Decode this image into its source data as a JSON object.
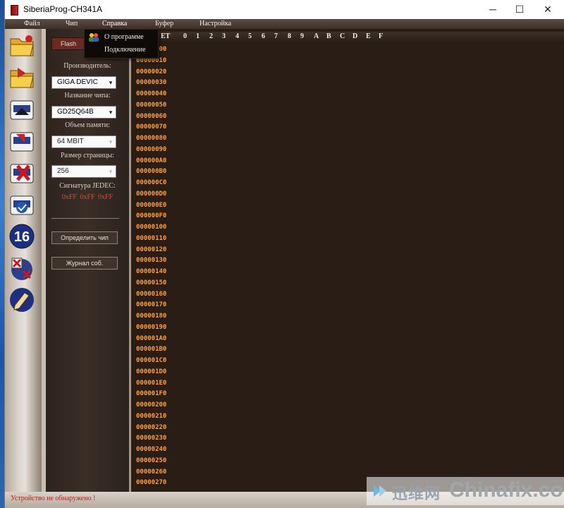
{
  "window": {
    "title": "SiberiaProg-CH341A",
    "controls": {
      "minimize": "─",
      "maximize": "☐",
      "close": "✕"
    }
  },
  "menu": {
    "items": [
      "Файл",
      "Чип",
      "Справка",
      "Буфер",
      "Настройка"
    ],
    "active": "Справка",
    "dropdown": [
      "О программе",
      "Подключение"
    ]
  },
  "toolbar": {
    "icons": [
      "open-folder-icon",
      "save-folder-icon",
      "read-chip-icon",
      "write-chip-icon",
      "erase-chip-icon",
      "verify-chip-icon",
      "bit16-icon",
      "blank-check-icon",
      "edit-icon"
    ],
    "bit_label": "16"
  },
  "panel": {
    "tab": "Flash",
    "manufacturer_label": "Производитель:",
    "manufacturer_value": "GIGA DEVIC",
    "chip_label": "Название чипа:",
    "chip_value": "GD25Q64B",
    "memory_label": "Объем памяти:",
    "memory_value": "64 MBIT",
    "page_label": "Размер страницы:",
    "page_value": "256",
    "jedec_label": "Сигнатура JEDEC:",
    "jedec_value": "0xFF  0xFF  0xFF",
    "detect_button": "Определить чип",
    "log_button": "Журнал соб."
  },
  "hex": {
    "header_label": "ET",
    "columns": [
      "0",
      "1",
      "2",
      "3",
      "4",
      "5",
      "6",
      "7",
      "8",
      "9",
      "A",
      "B",
      "C",
      "D",
      "E",
      "F"
    ],
    "offsets": [
      "00000000",
      "00000010",
      "00000020",
      "00000030",
      "00000040",
      "00000050",
      "00000060",
      "00000070",
      "00000080",
      "00000090",
      "000000A0",
      "000000B0",
      "000000C0",
      "000000D0",
      "000000E0",
      "000000F0",
      "00000100",
      "00000110",
      "00000120",
      "00000130",
      "00000140",
      "00000150",
      "00000160",
      "00000170",
      "00000180",
      "00000190",
      "000001A0",
      "000001B0",
      "000001C0",
      "000001D0",
      "000001E0",
      "000001F0",
      "00000200",
      "00000210",
      "00000220",
      "00000230",
      "00000240",
      "00000250",
      "00000260",
      "00000270"
    ]
  },
  "status": "Устройство не обнаружено !",
  "watermark": {
    "cn": "迅维网",
    "en": "Chinafix.com"
  },
  "colors": {
    "accent": "#ff9e3e",
    "status_text": "#b2231b",
    "jedec_text": "#e0473a"
  }
}
